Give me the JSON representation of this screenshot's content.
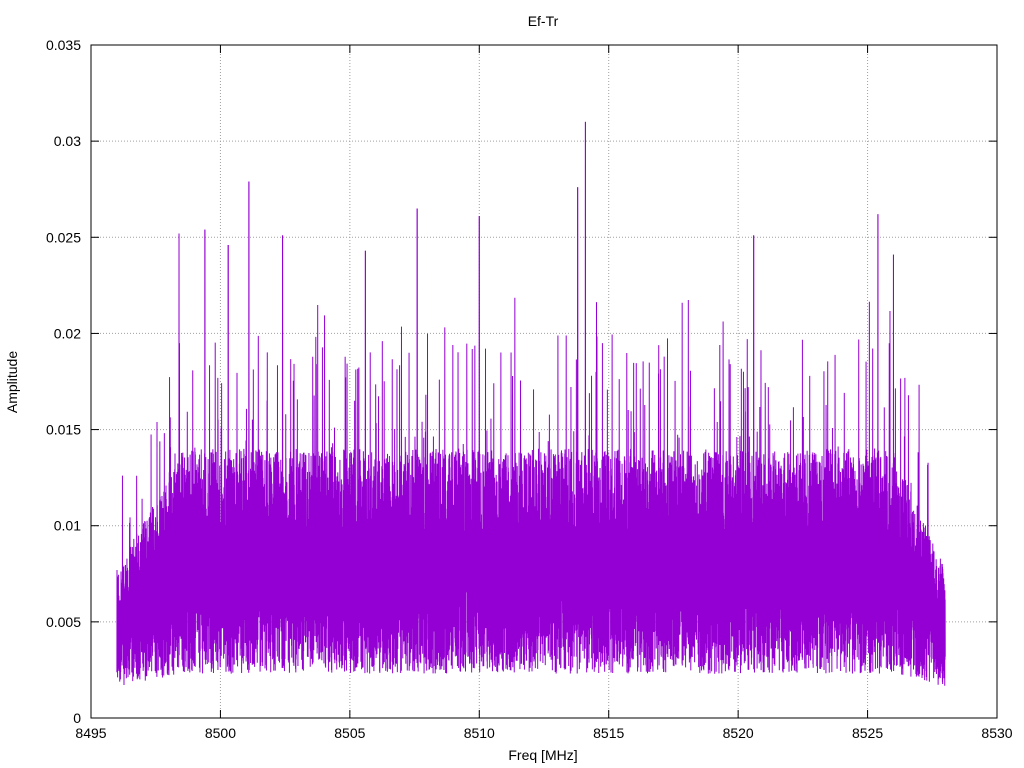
{
  "chart_data": {
    "type": "line",
    "title": "Ef-Tr",
    "xlabel": "Freq [MHz]",
    "ylabel": "Amplitude",
    "xlim": [
      8495,
      8530
    ],
    "ylim": [
      0,
      0.035
    ],
    "x_ticks": [
      "8495",
      "8500",
      "8505",
      "8510",
      "8515",
      "8520",
      "8525",
      "8530"
    ],
    "y_ticks": [
      "0",
      "0.005",
      "0.01",
      "0.015",
      "0.02",
      "0.025",
      "0.03",
      "0.035"
    ],
    "grid": true,
    "series": [
      {
        "color": "#9400d3",
        "x_start": 8496.0,
        "x_end": 8528.0,
        "typical_range": [
          0.003,
          0.013
        ],
        "peaks": [
          {
            "x": 8498.4,
            "y": 0.0252
          },
          {
            "x": 8499.4,
            "y": 0.0254
          },
          {
            "x": 8500.3,
            "y": 0.0246
          },
          {
            "x": 8501.1,
            "y": 0.0279
          },
          {
            "x": 8502.4,
            "y": 0.0251
          },
          {
            "x": 8505.6,
            "y": 0.0243
          },
          {
            "x": 8507.6,
            "y": 0.0265
          },
          {
            "x": 8510.0,
            "y": 0.0261
          },
          {
            "x": 8513.8,
            "y": 0.0276
          },
          {
            "x": 8514.1,
            "y": 0.031
          },
          {
            "x": 8520.6,
            "y": 0.0251
          },
          {
            "x": 8525.4,
            "y": 0.0262
          },
          {
            "x": 8526.0,
            "y": 0.0241
          }
        ]
      }
    ]
  }
}
